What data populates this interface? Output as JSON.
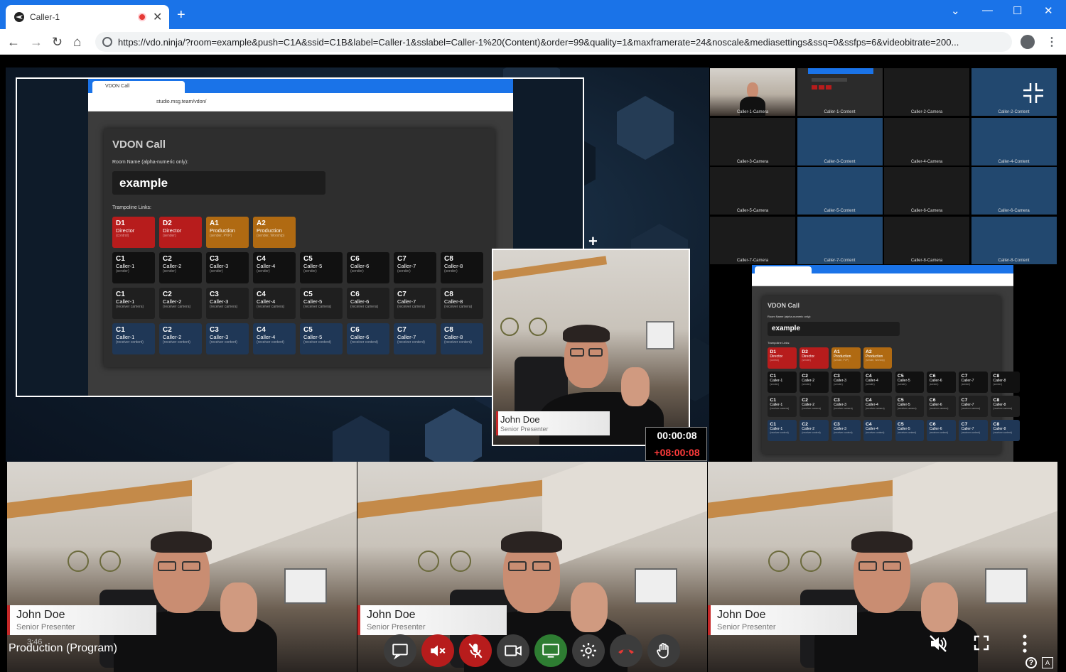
{
  "browser": {
    "tab_title": "Caller-1",
    "url": "https://vdo.ninja/?room=example&push=C1A&ssid=C1B&label=Caller-1&sslabel=Caller-1%20(Content)&order=99&quality=1&maxframerate=24&noscale&mediasettings&ssq=0&ssfps=6&videobitrate=200...",
    "new_tab": "+",
    "close": "✕",
    "minimize": "—",
    "maximize": "☐",
    "win_close": "✕",
    "tab_list": "⌄",
    "back": "←",
    "forward": "→",
    "reload": "↻",
    "home": "⌂",
    "menu": "⋮"
  },
  "screen_share": {
    "mini_tab_title": "VDON Call",
    "mini_url": "studio.msg.team/vdon/",
    "panel_title": "VDON Call",
    "room_label": "Room Name (alpha-numeric only):",
    "room_value": "example",
    "trampoline_label": "Trampoline Links:",
    "row_a": [
      {
        "code": "D1",
        "name": "Director",
        "sub": "(control)",
        "color": "#b71c1c"
      },
      {
        "code": "D2",
        "name": "Director",
        "sub": "(sender)",
        "color": "#b71c1c"
      },
      {
        "code": "A1",
        "name": "Production",
        "sub": "(sender, PVP)",
        "color": "#b06a12"
      },
      {
        "code": "A2",
        "name": "Production",
        "sub": "(sender, Worship)",
        "color": "#b06a12"
      }
    ],
    "row_b": [
      {
        "code": "C1",
        "name": "Caller-1",
        "sub": "(sender)"
      },
      {
        "code": "C2",
        "name": "Caller-2",
        "sub": "(sender)"
      },
      {
        "code": "C3",
        "name": "Caller-3",
        "sub": "(sender)"
      },
      {
        "code": "C4",
        "name": "Caller-4",
        "sub": "(sender)"
      },
      {
        "code": "C5",
        "name": "Caller-5",
        "sub": "(sender)"
      },
      {
        "code": "C6",
        "name": "Caller-6",
        "sub": "(sender)"
      },
      {
        "code": "C7",
        "name": "Caller-7",
        "sub": "(sender)"
      },
      {
        "code": "C8",
        "name": "Caller-8",
        "sub": "(sender)"
      }
    ],
    "row_c": [
      {
        "code": "C1",
        "name": "Caller-1",
        "sub": "(receiver camera)"
      },
      {
        "code": "C2",
        "name": "Caller-2",
        "sub": "(receiver camera)"
      },
      {
        "code": "C3",
        "name": "Caller-3",
        "sub": "(receiver camera)"
      },
      {
        "code": "C4",
        "name": "Caller-4",
        "sub": "(receiver camera)"
      },
      {
        "code": "C5",
        "name": "Caller-5",
        "sub": "(receiver camera)"
      },
      {
        "code": "C6",
        "name": "Caller-6",
        "sub": "(receiver camera)"
      },
      {
        "code": "C7",
        "name": "Caller-7",
        "sub": "(receiver camera)"
      },
      {
        "code": "C8",
        "name": "Caller-8",
        "sub": "(receiver camera)"
      }
    ],
    "row_d": [
      {
        "code": "C1",
        "name": "Caller-1",
        "sub": "(receiver content)"
      },
      {
        "code": "C2",
        "name": "Caller-2",
        "sub": "(receiver content)"
      },
      {
        "code": "C3",
        "name": "Caller-3",
        "sub": "(receiver content)"
      },
      {
        "code": "C4",
        "name": "Caller-4",
        "sub": "(receiver content)"
      },
      {
        "code": "C5",
        "name": "Caller-5",
        "sub": "(receiver content)"
      },
      {
        "code": "C6",
        "name": "Caller-6",
        "sub": "(receiver content)"
      },
      {
        "code": "C7",
        "name": "Caller-7",
        "sub": "(receiver content)"
      },
      {
        "code": "C8",
        "name": "Caller-8",
        "sub": "(receiver content)"
      }
    ]
  },
  "pip": {
    "name": "John Doe",
    "role": "Senior Presenter"
  },
  "timer": {
    "elapsed": "00:00:08",
    "offset": "+08:00:08"
  },
  "grid": {
    "cells": [
      "Caller-1-Camera",
      "Caller-1-Content",
      "Caller-2-Camera",
      "Caller-2-Content",
      "Caller-3-Camera",
      "Caller-3-Content",
      "Caller-4-Camera",
      "Caller-4-Content",
      "Caller-5-Camera",
      "Caller-5-Content",
      "Caller-6-Camera",
      "Caller-6-Camera",
      "Caller-7-Camera",
      "Caller-7-Content",
      "Caller-8-Camera",
      "Caller-8-Content"
    ]
  },
  "bottom": [
    {
      "name": "John Doe",
      "role": "Senior Presenter"
    },
    {
      "name": "John Doe",
      "role": "Senior Presenter"
    },
    {
      "name": "John Doe",
      "role": "Senior Presenter"
    }
  ],
  "program_label": "Production (Program)",
  "program_time": "3:46",
  "controls": {
    "help": "?",
    "translate": "A"
  }
}
